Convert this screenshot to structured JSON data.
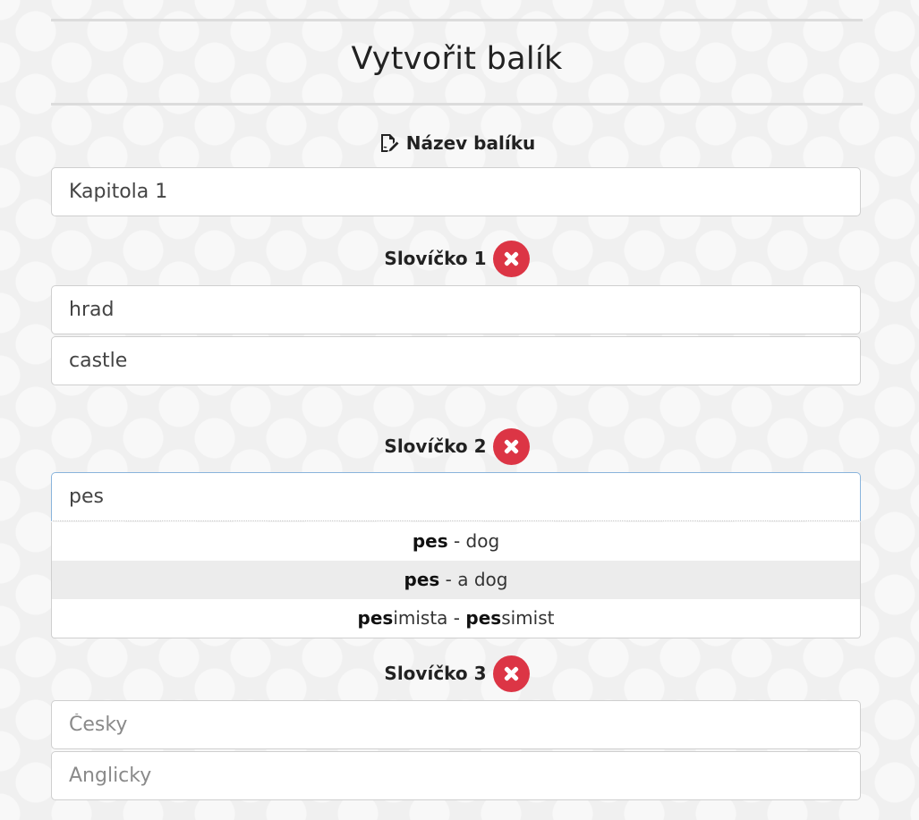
{
  "page": {
    "title": "Vytvořit balík"
  },
  "package": {
    "label": "Název balíku",
    "value": "Kapitola 1",
    "label_icon": "edit-document-icon"
  },
  "words": [
    {
      "label": "Slovíčko 1",
      "czech": "hrad",
      "english": "castle"
    },
    {
      "label": "Slovíčko 2",
      "czech": "pes",
      "english": ""
    },
    {
      "label": "Slovíčko 3",
      "czech": "",
      "english": ""
    }
  ],
  "placeholders": {
    "czech": "Česky",
    "english": "Anglicky"
  },
  "autocomplete": [
    {
      "match1": "pes",
      "rest1": "",
      "sep": " - ",
      "match2": "",
      "rest2": "dog"
    },
    {
      "match1": "pes",
      "rest1": "",
      "sep": " - ",
      "match2": "",
      "rest2": "a dog"
    },
    {
      "match1": "pes",
      "rest1": "imista",
      "sep": " - ",
      "match2": "pes",
      "rest2": "simist"
    }
  ],
  "colors": {
    "remove": "#dc3545",
    "highlight": "#ececec"
  },
  "icons": {
    "remove": "close-circle-icon"
  }
}
